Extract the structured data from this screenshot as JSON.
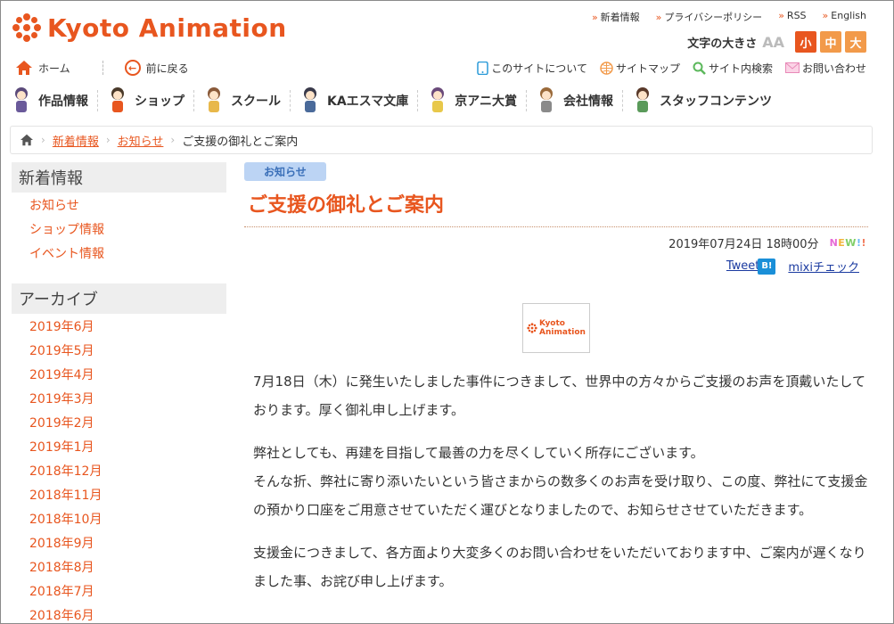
{
  "header": {
    "logo_text": "Kyoto Animation",
    "top_links": [
      "新着情報",
      "プライバシーポリシー",
      "RSS",
      "English"
    ],
    "font_size_label": "文字の大きさ",
    "font_size_aa": "AA",
    "font_sizes": [
      "小",
      "中",
      "大"
    ]
  },
  "nav2": {
    "home": "ホーム",
    "back": "前に戻る",
    "right": [
      "このサイトについて",
      "サイトマップ",
      "サイト内検索",
      "お問い合わせ"
    ]
  },
  "main_nav": [
    "作品情報",
    "ショップ",
    "スクール",
    "KAエスマ文庫",
    "京アニ大賞",
    "会社情報",
    "スタッフコンテンツ"
  ],
  "breadcrumb": [
    "新着情報",
    "お知らせ",
    "ご支援の御礼とご案内"
  ],
  "sidebar": {
    "news_head": "新着情報",
    "news_items": [
      "お知らせ",
      "ショップ情報",
      "イベント情報"
    ],
    "archive_head": "アーカイブ",
    "archive_items": [
      "2019年6月",
      "2019年5月",
      "2019年4月",
      "2019年3月",
      "2019年2月",
      "2019年1月",
      "2018年12月",
      "2018年11月",
      "2018年10月",
      "2018年9月",
      "2018年8月",
      "2018年7月",
      "2018年6月"
    ]
  },
  "article": {
    "tag": "お知らせ",
    "title": "ご支援の御礼とご案内",
    "date": "2019年07月24日 18時00分",
    "new_badge": [
      "N",
      "E",
      "W",
      "!",
      "!"
    ],
    "tweet": "Tweet",
    "hatena": "B!",
    "mixi": "mixiチェック",
    "logo_line1": "Kyoto",
    "logo_line2": "Animation",
    "paragraphs": [
      "7月18日（木）に発生いたしました事件につきまして、世界中の方々からご支援のお声を頂戴いたしております。厚く御礼申し上げます。",
      "弊社としても、再建を目指して最善の力を尽くしていく所存にございます。\nそんな折、弊社に寄り添いたいという皆さまからの数多くのお声を受け取り、この度、弊社にて支援金の預かり口座をご用意させていただく運びとなりましたので、お知らせさせていただきます。",
      "支援金につきまして、各方面より大変多くのお問い合わせをいただいております中、ご案内が遅くなりました事、お詫び申し上げます。"
    ]
  },
  "colors": {
    "accent": "#e8561f",
    "tag_bg": "#bcd4f4",
    "link_blue": "#1a3aa0"
  }
}
